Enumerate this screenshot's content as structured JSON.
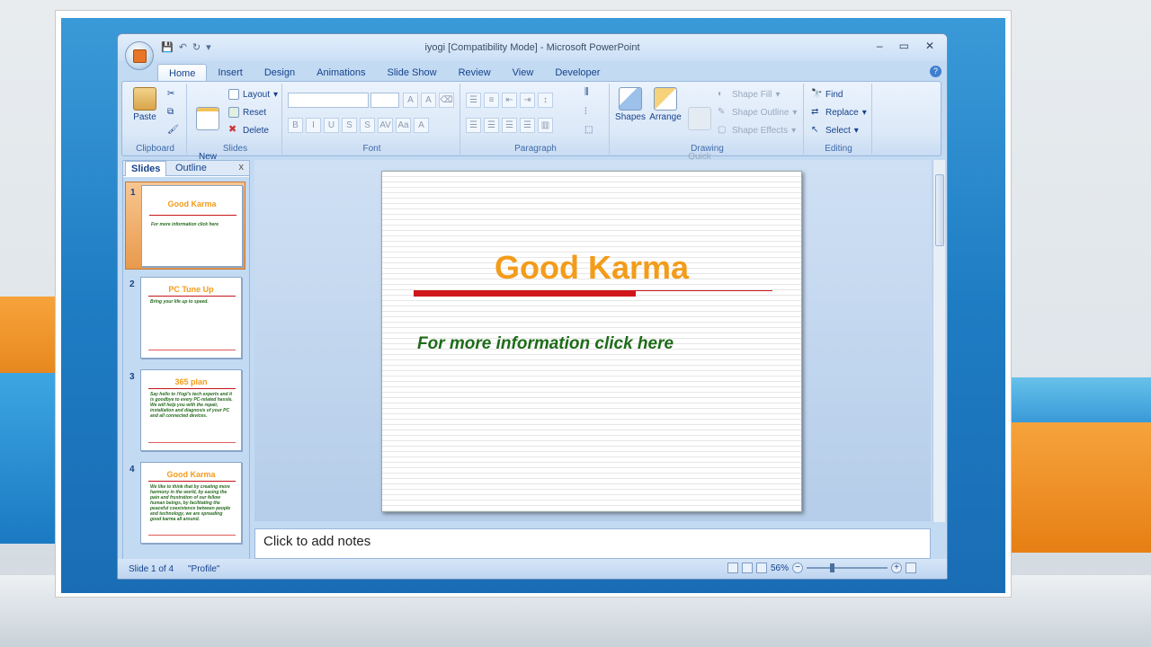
{
  "window": {
    "title": "iyogi [Compatibility Mode] - Microsoft PowerPoint",
    "minimize": "–",
    "maximize": "▭",
    "close": "✕"
  },
  "ribbon_tabs": [
    "Home",
    "Insert",
    "Design",
    "Animations",
    "Slide Show",
    "Review",
    "View",
    "Developer"
  ],
  "ribbon": {
    "clipboard": {
      "label": "Clipboard",
      "paste": "Paste"
    },
    "slides": {
      "label": "Slides",
      "new_slide": "New\nSlide",
      "layout": "Layout",
      "reset": "Reset",
      "delete": "Delete"
    },
    "font": {
      "label": "Font"
    },
    "paragraph": {
      "label": "Paragraph"
    },
    "drawing": {
      "label": "Drawing",
      "shapes": "Shapes",
      "arrange": "Arrange",
      "quick_styles": "Quick\nStyles",
      "shape_fill": "Shape Fill",
      "shape_outline": "Shape Outline",
      "shape_effects": "Shape Effects"
    },
    "editing": {
      "label": "Editing",
      "find": "Find",
      "replace": "Replace",
      "select": "Select"
    }
  },
  "panel": {
    "tab_slides": "Slides",
    "tab_outline": "Outline",
    "close": "x"
  },
  "thumbnails": [
    {
      "num": "1",
      "title": "Good Karma",
      "body": "For more information  click here"
    },
    {
      "num": "2",
      "title": "PC Tune Up",
      "body": "Bring your life up to speed."
    },
    {
      "num": "3",
      "title": "365 plan",
      "body": "Say hello to iYogi's tech experts and it is goodbye to every PC-related hassle. We will help you with the repair, installation and diagnosis of your PC and all connected devices."
    },
    {
      "num": "4",
      "title": "Good Karma",
      "body": "We like to think that by creating more harmony in the world, by easing the pain and frustration of our fellow human beings, by facilitating the peaceful coexistence between people and technology, we are spreading good karma all around."
    }
  ],
  "slide": {
    "title": "Good Karma",
    "body": "For more information click here"
  },
  "notes": {
    "placeholder": "Click to add notes"
  },
  "status": {
    "slide": "Slide 1 of 4",
    "theme": "\"Profile\"",
    "zoom": "56%"
  }
}
